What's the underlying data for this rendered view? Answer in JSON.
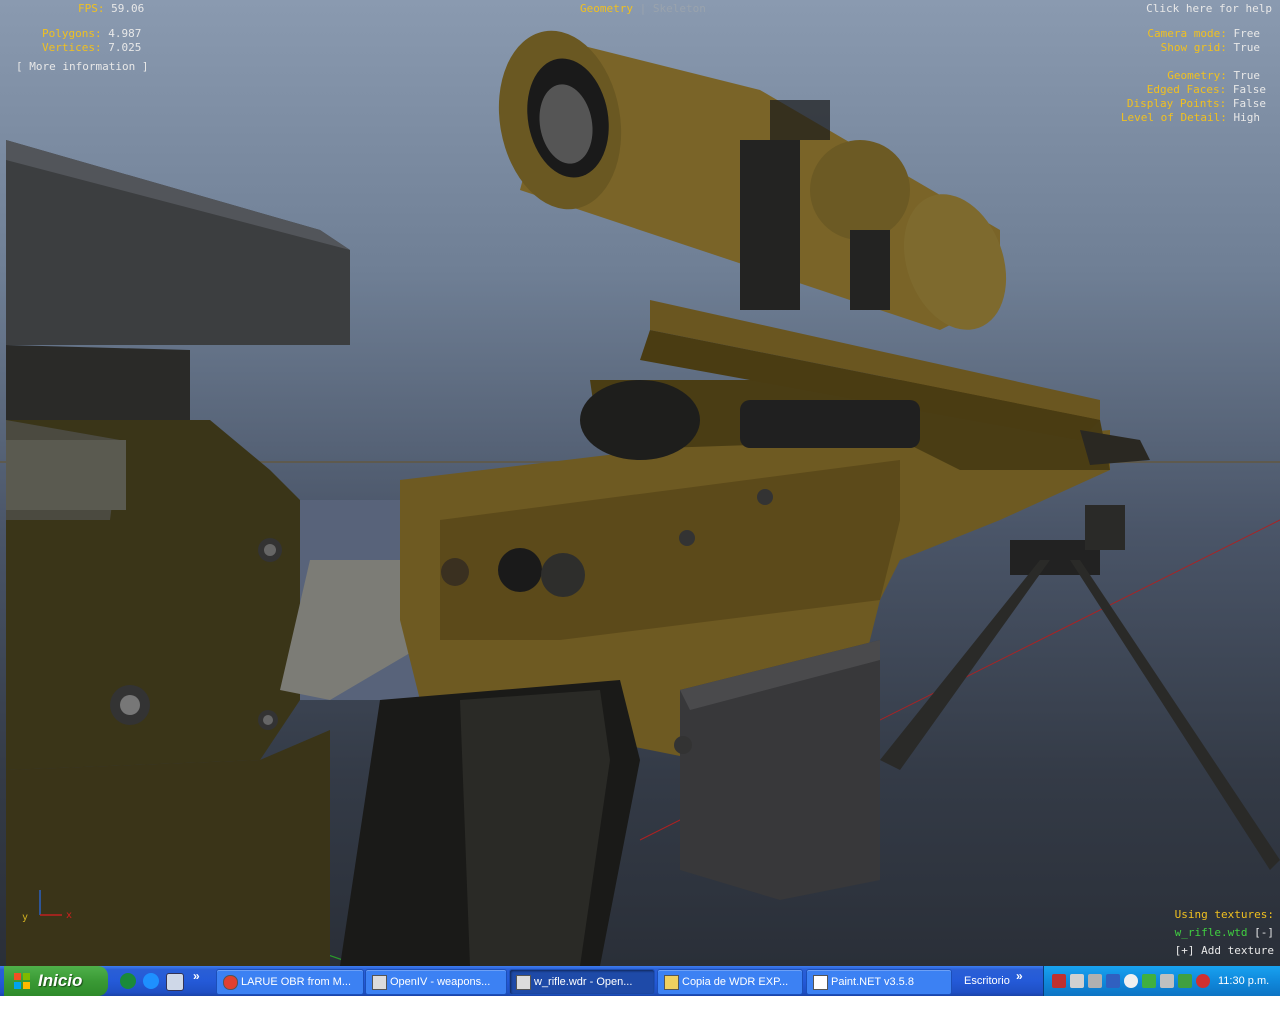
{
  "hud": {
    "fps_label": "FPS:",
    "fps_value": "59.06",
    "polygons_label": "Polygons:",
    "polygons_value": "4.987",
    "vertices_label": "Vertices:",
    "vertices_value": "7.025",
    "more_info": "[ More information ]",
    "tab_geometry": "Geometry",
    "tab_sep": "|",
    "tab_skeleton": "Skeleton",
    "help": "Click here for help",
    "camera_mode_label": "Camera mode:",
    "camera_mode_value": "Free",
    "show_grid_label": "Show grid:",
    "show_grid_value": "True",
    "geometry_label": "Geometry:",
    "geometry_value": "True",
    "edged_faces_label": "Edged Faces:",
    "edged_faces_value": "False",
    "display_points_label": "Display Points:",
    "display_points_value": "False",
    "lod_label": "Level of Detail:",
    "lod_value": "High",
    "using_textures": "Using textures:",
    "texture_file": "w_rifle.wtd",
    "texture_remove": "[-]",
    "add_texture": "[+] Add texture",
    "axis_y": "y",
    "axis_x": "x"
  },
  "taskbar": {
    "start_label": "Inicio",
    "chevron": "»",
    "tasks": [
      {
        "label": "LARUE OBR from M..."
      },
      {
        "label": "OpenIV - weapons..."
      },
      {
        "label": "w_rifle.wdr - Open..."
      },
      {
        "label": "Copia de WDR EXP..."
      },
      {
        "label": "Paint.NET v3.5.8"
      }
    ],
    "desktop_label": "Escritorio",
    "clock": "11:30 p.m."
  },
  "colors": {
    "hud_key": "#f0c020",
    "hud_value": "#e8e8e8",
    "rifle_tan": "#6e5a22",
    "taskbar_blue": "#245ad8",
    "start_green": "#3a9a35"
  }
}
